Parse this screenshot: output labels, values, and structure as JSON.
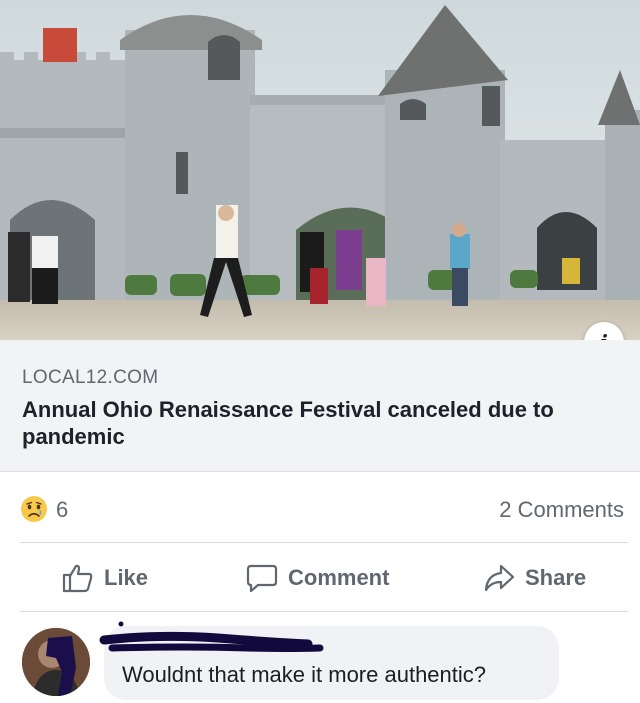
{
  "link_preview": {
    "domain": "LOCAL12.COM",
    "title": "Annual Ohio Renaissance Festival canceled due to pandemic",
    "info_icon": "info-icon"
  },
  "stats": {
    "reaction_icon": "sad-emoji-icon",
    "reaction_count": "6",
    "comments": "2 Comments"
  },
  "actions": {
    "like": "Like",
    "comment": "Comment",
    "share": "Share"
  },
  "comment": {
    "text": "Wouldnt that make it more authentic?"
  },
  "colors": {
    "secondary_text": "#606770",
    "link_box_bg": "#f2f3f5",
    "bubble_bg": "#f0f2f5"
  }
}
